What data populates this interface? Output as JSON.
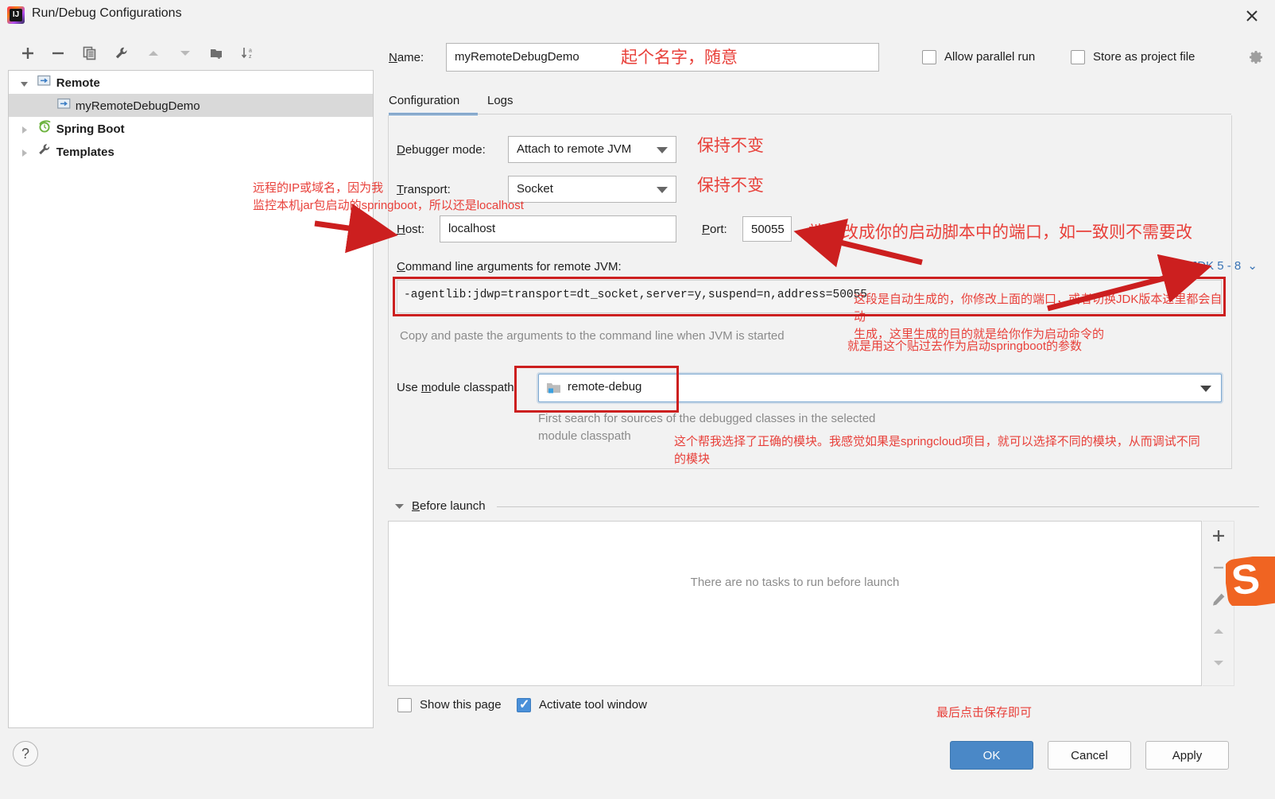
{
  "window": {
    "title": "Run/Debug Configurations",
    "app_icon": "intellij-idea-icon",
    "close_icon": "close-icon"
  },
  "toolbar": {
    "items": [
      {
        "name": "add-configuration-button",
        "icon": "plus-icon"
      },
      {
        "name": "remove-configuration-button",
        "icon": "minus-icon"
      },
      {
        "name": "copy-configuration-button",
        "icon": "copy-icon"
      },
      {
        "name": "edit-templates-button",
        "icon": "wrench-icon"
      },
      {
        "name": "move-up-button",
        "icon": "triangle-up-icon"
      },
      {
        "name": "move-down-button",
        "icon": "triangle-down-icon"
      },
      {
        "name": "new-folder-button",
        "icon": "folder-add-icon"
      },
      {
        "name": "sort-configurations-button",
        "icon": "sort-az-icon"
      }
    ]
  },
  "tree": {
    "items": [
      {
        "label": "Remote",
        "icon": "remote-icon",
        "depth": 0,
        "expanded": true,
        "bold": true,
        "selected": false,
        "has_toggle": true
      },
      {
        "label": "myRemoteDebugDemo",
        "icon": "remote-icon",
        "depth": 1,
        "expanded": false,
        "bold": false,
        "selected": true,
        "has_toggle": false
      },
      {
        "label": "Spring Boot",
        "icon": "spring-boot-icon",
        "depth": 0,
        "expanded": false,
        "bold": true,
        "selected": false,
        "has_toggle": true
      },
      {
        "label": "Templates",
        "icon": "wrench-icon",
        "depth": 0,
        "expanded": false,
        "bold": true,
        "selected": false,
        "has_toggle": true
      }
    ]
  },
  "header": {
    "name_label": "Name:",
    "name_value": "myRemoteDebugDemo",
    "allow_parallel_run_label": "Allow parallel run",
    "allow_parallel_run_checked": false,
    "store_as_project_file_label": "Store as project file",
    "store_as_project_file_checked": false,
    "settings_icon": "gear-icon"
  },
  "tabs": {
    "items": [
      {
        "label": "Configuration",
        "selected": true
      },
      {
        "label": "Logs",
        "selected": false
      }
    ]
  },
  "configuration": {
    "debugger_mode_label": "Debugger mode:",
    "debugger_mode_value": "Attach to remote JVM",
    "transport_label": "Transport:",
    "transport_value": "Socket",
    "host_label": "Host:",
    "host_value": "localhost",
    "port_label": "Port:",
    "port_value": "50055",
    "args_label": "Command line arguments for remote JVM:",
    "args_value": "-agentlib:jdwp=transport=dt_socket,server=y,suspend=n,address=50055",
    "args_hint": "Copy and paste the arguments to the command line when JVM is started",
    "jdk_selector_value": "JDK 5 - 8",
    "module_classpath_label": "Use module classpath:",
    "module_classpath_value": "remote-debug",
    "module_classpath_icon": "module-folder-icon",
    "module_hint_line1": "First search for sources of the debugged classes in the selected",
    "module_hint_line2": "module classpath"
  },
  "before_launch": {
    "title": "Before launch",
    "empty_text": "There are no tasks to run before launch",
    "side_buttons": [
      {
        "name": "add-task-button",
        "icon": "plus-icon"
      },
      {
        "name": "remove-task-button",
        "icon": "minus-icon"
      },
      {
        "name": "edit-task-button",
        "icon": "pencil-icon"
      },
      {
        "name": "move-task-up-button",
        "icon": "triangle-up-icon"
      },
      {
        "name": "move-task-down-button",
        "icon": "triangle-down-icon"
      }
    ]
  },
  "footer": {
    "show_this_page_label": "Show this page",
    "show_this_page_checked": false,
    "activate_tool_window_label": "Activate tool window",
    "activate_tool_window_checked": true,
    "ok_label": "OK",
    "cancel_label": "Cancel",
    "apply_label": "Apply",
    "help_icon": "question-mark-icon"
  },
  "annotations": {
    "name_note": "起个名字，随意",
    "debugger_mode_note": "保持不变",
    "transport_note": "保持不变",
    "host_note": "远程的IP或域名，因为我\n监控本机jar包启动的springboot，所以还是localhost",
    "port_note": "端口改成你的启动脚本中的端口，如一致则不需要改",
    "args_note": "这段是自动生成的，你修改上面的端口，或者切换JDK版本这里都会自动\n生成，这里生成的目的就是给你作为启动命令的",
    "paste_note": "就是用这个贴过去作为启动springboot的参数",
    "module_note": "这个帮我选择了正确的模块。我感觉如果是springcloud项目，就可以选择不同的模块，从而调试不同\n的模块",
    "save_note": "最后点击保存即可"
  },
  "colors": {
    "annotation_red": "#e8403a",
    "highlight_box_red": "#cc1f1f",
    "primary_button_blue": "#4a88c7",
    "link_blue": "#3a74b5",
    "selection_gray": "#d9d9d9",
    "watermark_orange": "#f06422"
  },
  "watermark": {
    "icon": "csdn-logo-icon"
  }
}
